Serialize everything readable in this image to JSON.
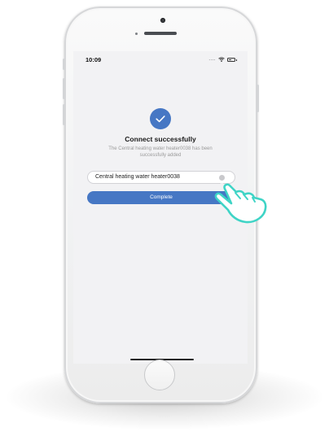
{
  "status_bar": {
    "time": "10:09"
  },
  "dialog": {
    "title": "Connect successfully",
    "subtitle": "The Central heating water heater0038 has been successfully added"
  },
  "device_name_field": {
    "value": "Central heating water heater0038"
  },
  "buttons": {
    "complete_label": "Complete"
  },
  "icons": {
    "success": "checkmark-icon",
    "clear": "clear-circle-icon",
    "wifi": "wifi-icon",
    "battery": "battery-icon",
    "cursor": "hand-pointer-icon"
  },
  "colors": {
    "accent": "#4677c4",
    "cursor_stroke": "#3fd4c6"
  },
  "battery_level": 0.55
}
